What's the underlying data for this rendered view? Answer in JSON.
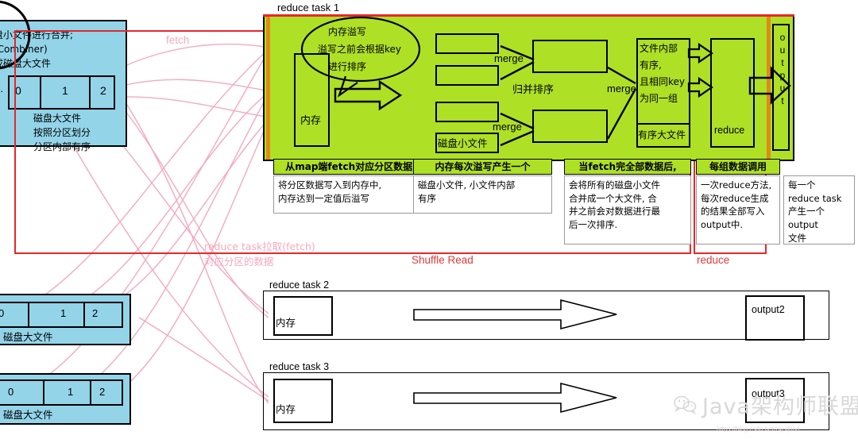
{
  "titles": {
    "reduce_task_1": "reduce task 1",
    "reduce_task_2": "reduce task 2",
    "reduce_task_3": "reduce task 3"
  },
  "phase_labels": {
    "shuffle_read": "Shuffle Read",
    "reduce": "reduce",
    "fetch": "fetch",
    "fetch_note_line1": "reduce task拉取(fetch)",
    "fetch_note_line2": "对应分区的数据"
  },
  "map_side": {
    "top_box": {
      "line1": "盘小文件进行合并;",
      "line2": "(Combiner)",
      "line3": "成磁盘大文件",
      "partitions": [
        "0",
        "1",
        "2"
      ],
      "note1": "磁盘大文件",
      "note2": "按照分区划分",
      "note3": "分区内部有序"
    },
    "mid_box": {
      "partitions": [
        "0",
        "1",
        "2"
      ],
      "caption": "磁盘大文件"
    },
    "bottom_box": {
      "partitions": [
        "0",
        "1",
        "2"
      ],
      "caption": "磁盘大文件"
    }
  },
  "task1": {
    "memory_label": "内存",
    "callout": {
      "line1": "内存溢写",
      "line2": "溢写之前会根据key",
      "line3": "进行排序"
    },
    "spill_file_label": "磁盘小文件",
    "merge_label_1": "merge",
    "merge_label_2": "merge",
    "merge_label_3": "merge",
    "merge_sort_label": "归并排序",
    "big_file": {
      "line1": "文件内部",
      "line2": "有序,",
      "line3": "且相同key",
      "line4": "为同一组",
      "footer": "有序大文件"
    },
    "reduce_label": "reduce",
    "output_label": "output"
  },
  "captions": [
    {
      "head": "从map端fetch对应分区数据,",
      "body": "将分区数据写入到内存中,\n内存达到一定值后溢写"
    },
    {
      "head": "内存每次溢写产生一个",
      "body": "磁盘小文件, 小文件内部\n有序"
    },
    {
      "head": "当fetch完全部数据后,",
      "body": "会将所有的磁盘小文件\n合并成一个大文件, 合\n并之前会对数据进行最\n后一次排序."
    },
    {
      "head": "每组数据调用",
      "body": "一次reduce方法,\n每次reduce生成\n的结果全部写入\noutput中."
    },
    {
      "head": "",
      "body": "  每一个\nreduce task\n产生一个output\n文件"
    }
  ],
  "task2": {
    "memory_label": "内存",
    "output_label": "output2"
  },
  "task3": {
    "memory_label": "内存",
    "output_label": "output3"
  },
  "watermark": {
    "text": "Java架构师联盟",
    "url": "https://blog.csdn.net/zkjsljhao"
  },
  "colors": {
    "green": "#aee026",
    "blue": "#93d4e9",
    "red": "#e8262a",
    "pink": "#f5a9bd",
    "orange": "#e08a18"
  }
}
